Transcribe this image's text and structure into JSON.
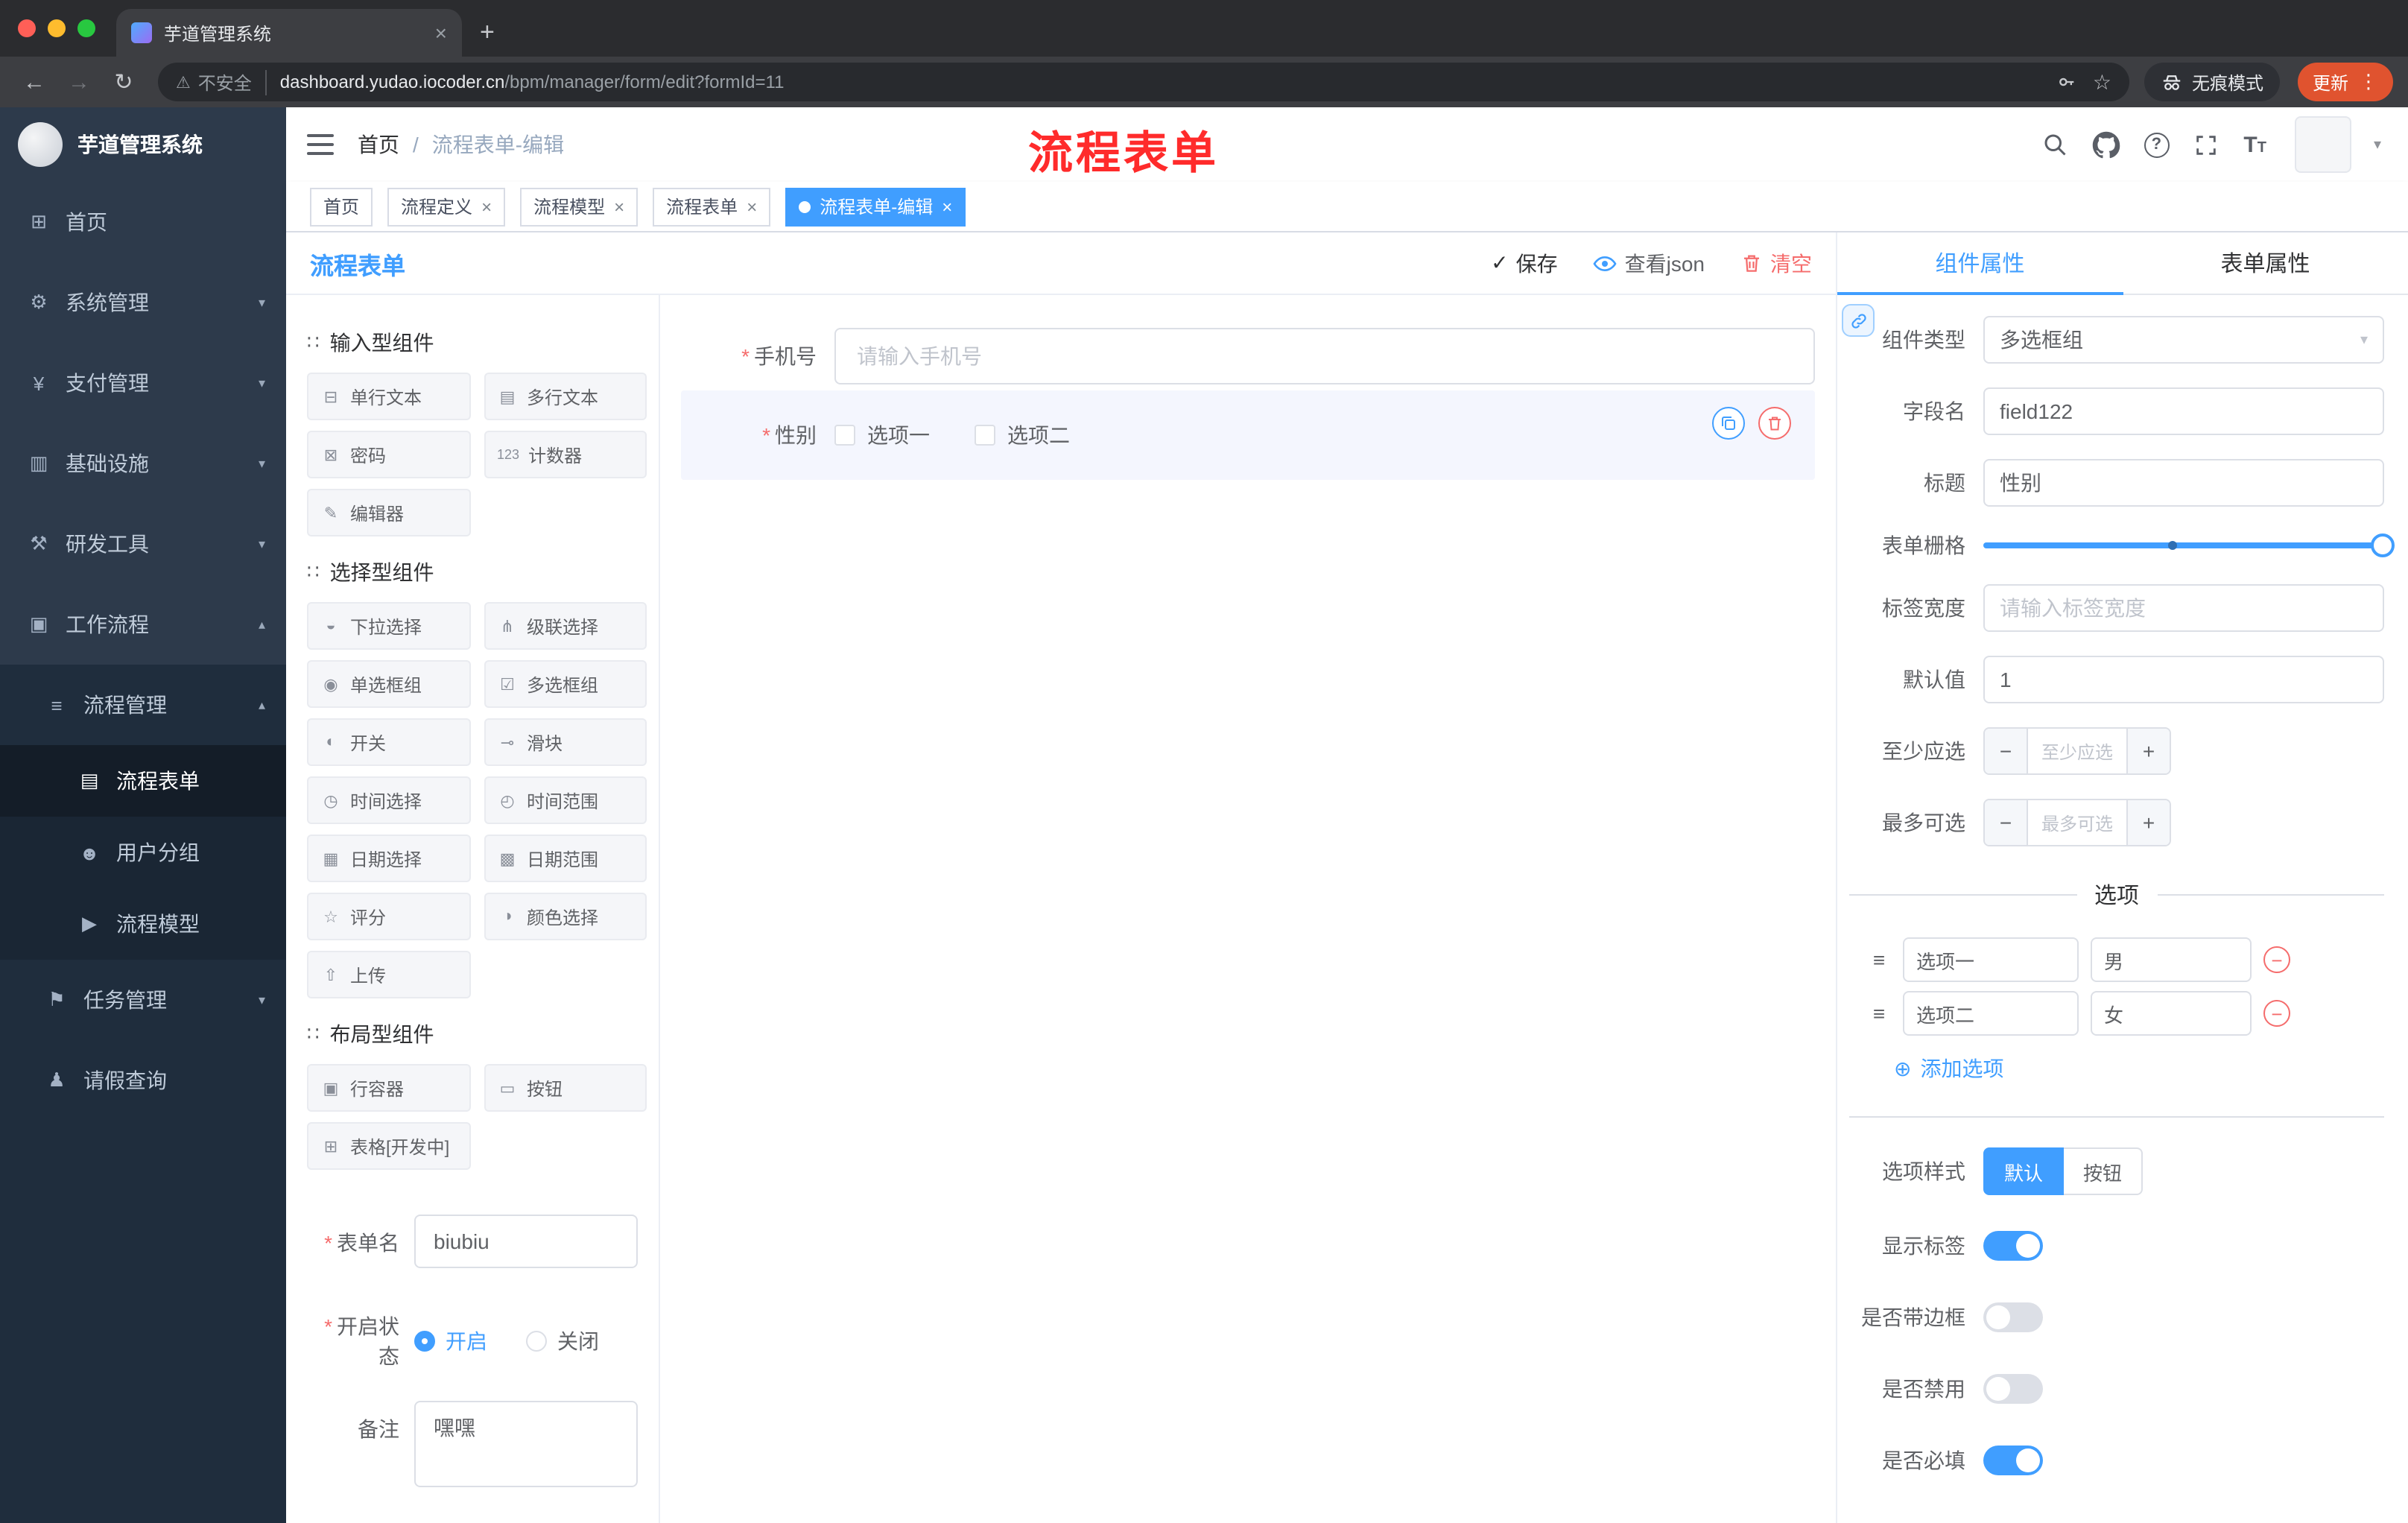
{
  "browser": {
    "tab_title": "芋道管理系统",
    "security_label": "不安全",
    "url_host": "dashboard.yudao.iocoder.cn",
    "url_path": "/bpm/manager/form/edit?formId=11",
    "incognito_label": "无痕模式",
    "update_label": "更新"
  },
  "annotation": {
    "text": "流程表单"
  },
  "sidebar": {
    "title": "芋道管理系统",
    "top_items": [
      "首页",
      "系统管理",
      "支付管理",
      "基础设施",
      "研发工具",
      "工作流程"
    ],
    "submenu_title": "流程管理",
    "submenu_items": [
      "流程表单",
      "用户分组",
      "流程模型"
    ],
    "extra_items": [
      "任务管理",
      "请假查询"
    ]
  },
  "navbar": {
    "breadcrumb_home": "首页",
    "breadcrumb_sep": "/",
    "breadcrumb_current": "流程表单-编辑"
  },
  "tags": [
    "首页",
    "流程定义",
    "流程模型",
    "流程表单",
    "流程表单-编辑"
  ],
  "designer": {
    "panel_title": "流程表单",
    "save_label": "保存",
    "view_json_label": "查看json",
    "clear_label": "清空",
    "sections": [
      {
        "title": "输入型组件",
        "items": [
          "单行文本",
          "多行文本",
          "密码",
          "计数器",
          "编辑器"
        ]
      },
      {
        "title": "选择型组件",
        "items": [
          "下拉选择",
          "级联选择",
          "单选框组",
          "多选框组",
          "开关",
          "滑块",
          "时间选择",
          "时间范围",
          "日期选择",
          "日期范围",
          "评分",
          "颜色选择",
          "上传"
        ]
      },
      {
        "title": "布局型组件",
        "items": [
          "行容器",
          "按钮",
          "表格[开发中]"
        ]
      }
    ],
    "form_name_label": "表单名",
    "form_name_value": "biubiu",
    "status_label": "开启状态",
    "status_on": "开启",
    "status_off": "关闭",
    "remark_label": "备注",
    "remark_value": "嘿嘿"
  },
  "canvas": {
    "phone_label": "手机号",
    "phone_placeholder": "请输入手机号",
    "gender_label": "性别",
    "gender_option1": "选项一",
    "gender_option2": "选项二"
  },
  "props": {
    "tab_component": "组件属性",
    "tab_form": "表单属性",
    "component_type_label": "组件类型",
    "component_type_value": "多选框组",
    "field_name_label": "字段名",
    "field_name_value": "field122",
    "title_label": "标题",
    "title_value": "性别",
    "grid_label": "表单栅格",
    "label_width_label": "标签宽度",
    "label_width_placeholder": "请输入标签宽度",
    "default_label": "默认值",
    "default_value": "1",
    "min_label": "至少应选",
    "min_placeholder": "至少应选",
    "max_label": "最多可选",
    "max_placeholder": "最多可选",
    "options_divider": "选项",
    "option_rows": [
      {
        "label": "选项一",
        "value": "男"
      },
      {
        "label": "选项二",
        "value": "女"
      }
    ],
    "add_option_label": "添加选项",
    "option_style_label": "选项样式",
    "style_default": "默认",
    "style_button": "按钮",
    "switch_rows": [
      {
        "label": "显示标签",
        "on": true
      },
      {
        "label": "是否带边框",
        "on": false
      },
      {
        "label": "是否禁用",
        "on": false
      },
      {
        "label": "是否必填",
        "on": true
      }
    ]
  },
  "icons": {
    "back": "←",
    "forward": "→",
    "reload": "↻",
    "star": "☆",
    "warning": "⚠",
    "menu_dots": "⋮",
    "close": "×",
    "new_tab": "+",
    "caret_down": "▾",
    "caret_up": "▴",
    "check": "✓",
    "question": "?",
    "font_size": "T",
    "add_circle": "⊕",
    "minus": "−",
    "plus": "+",
    "drag": "≡",
    "section_handle": "∷",
    "home": "⊞",
    "gear": "⚙",
    "currency": "¥",
    "infra": "▥",
    "tools": "⚒",
    "workflow": "▣",
    "list": "≡",
    "doc": "▤",
    "users": "☻",
    "plane": "▶",
    "task": "⚑",
    "person": "♟",
    "chip_input": "⊟",
    "chip_textarea": "▤",
    "chip_password": "⊠",
    "chip_counter": "123",
    "chip_editor": "✎",
    "chip_select": "◒",
    "chip_cascader": "⋔",
    "chip_radio": "◉",
    "chip_checkbox": "☑",
    "chip_switch": "◐",
    "chip_slider": "⊸",
    "chip_time": "◷",
    "chip_timerange": "◴",
    "chip_date": "▦",
    "chip_daterange": "▩",
    "chip_rate": "☆",
    "chip_color": "◑",
    "chip_upload": "⇧",
    "chip_row": "▣",
    "chip_button": "▭",
    "chip_table": "⊞"
  },
  "colors": {
    "primary": "#409eff",
    "danger": "#f56c6c",
    "annotation": "#ff2b2b"
  }
}
